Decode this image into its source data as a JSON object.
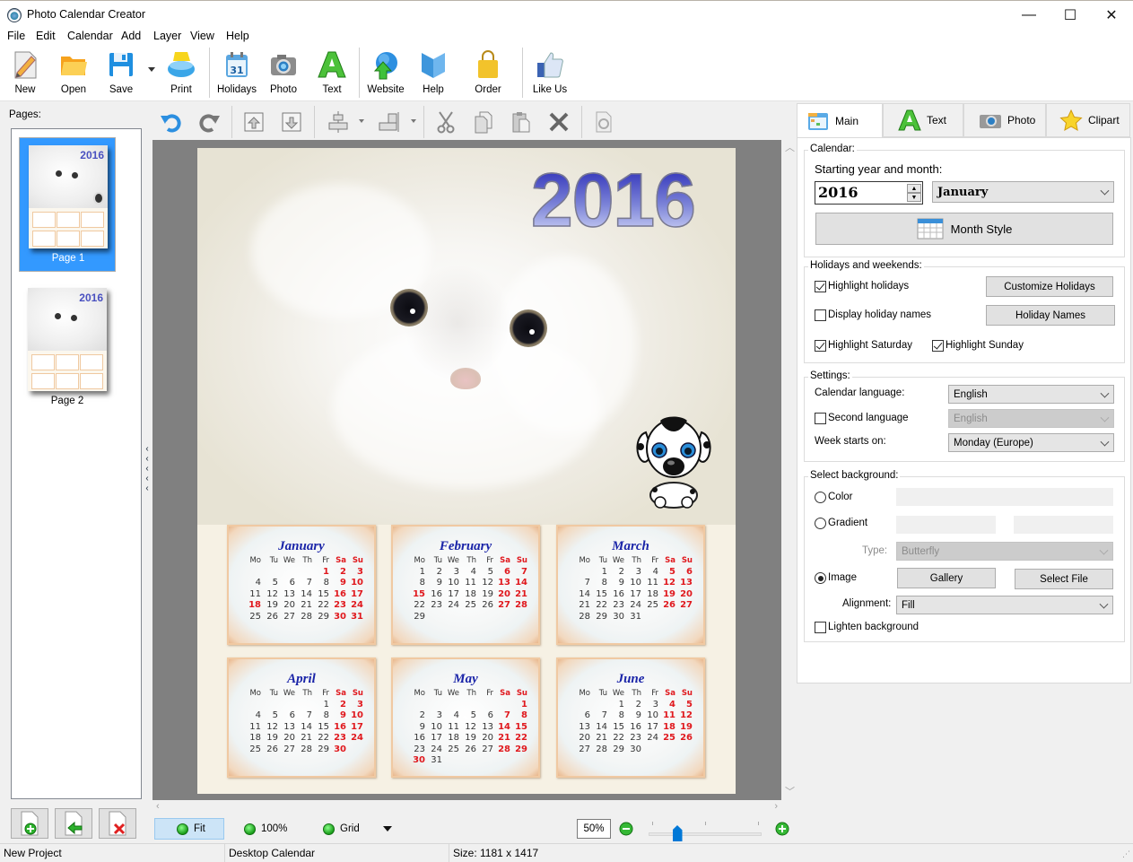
{
  "window": {
    "title": "Photo Calendar Creator",
    "minimize": "—",
    "maximize": "☐",
    "close": "✕"
  },
  "menu": [
    "File",
    "Edit",
    "Calendar",
    "Add",
    "Layer",
    "View",
    "Help"
  ],
  "toolbar": {
    "new": "New",
    "open": "Open",
    "save": "Save",
    "print": "Print",
    "holidays": "Holidays",
    "photo": "Photo",
    "text": "Text",
    "website": "Website",
    "help": "Help",
    "order": "Order",
    "like": "Like Us"
  },
  "pages": {
    "label": "Pages:",
    "items": [
      {
        "label": "Page 1",
        "selected": true
      },
      {
        "label": "Page 2",
        "selected": false
      }
    ]
  },
  "calendar_page": {
    "year": "2016",
    "weekday_headers": [
      "Mo",
      "Tu",
      "We",
      "Th",
      "Fr",
      "Sa",
      "Su"
    ],
    "months": [
      {
        "name": "January",
        "offset": 4,
        "days": 31,
        "holidays": [
          1,
          18
        ]
      },
      {
        "name": "February",
        "offset": 0,
        "days": 29,
        "holidays": [
          15
        ]
      },
      {
        "name": "March",
        "offset": 1,
        "days": 31,
        "holidays": []
      },
      {
        "name": "April",
        "offset": 4,
        "days": 30,
        "holidays": []
      },
      {
        "name": "May",
        "offset": 6,
        "days": 31,
        "holidays": [
          30
        ]
      },
      {
        "name": "June",
        "offset": 2,
        "days": 30,
        "holidays": []
      }
    ]
  },
  "tabs": [
    {
      "label": "Main",
      "active": true
    },
    {
      "label": "Text",
      "active": false
    },
    {
      "label": "Photo",
      "active": false
    },
    {
      "label": "Clipart",
      "active": false
    }
  ],
  "main": {
    "calendar_group": "Calendar:",
    "start_label": "Starting year and month:",
    "year_value": "2016",
    "month_value": "January",
    "month_style": "Month Style",
    "holidays_group": "Holidays and weekends:",
    "highlight_holidays": {
      "label": "Highlight holidays",
      "checked": true
    },
    "display_holiday_names": {
      "label": "Display holiday names",
      "checked": false
    },
    "highlight_saturday": {
      "label": "Highlight Saturday",
      "checked": true
    },
    "highlight_sunday": {
      "label": "Highlight Sunday",
      "checked": true
    },
    "customize_holidays": "Customize Holidays",
    "holiday_names": "Holiday Names",
    "settings_group": "Settings:",
    "calendar_language_label": "Calendar language:",
    "calendar_language": "English",
    "second_language": {
      "label": "Second language",
      "checked": false,
      "value": "English"
    },
    "week_starts_label": "Week starts on:",
    "week_starts": "Monday (Europe)",
    "background_group": "Select background:",
    "bg_color": {
      "label": "Color",
      "selected": false
    },
    "bg_gradient": {
      "label": "Gradient",
      "selected": false
    },
    "type_label": "Type:",
    "type_value": "Butterfly",
    "bg_image": {
      "label": "Image",
      "selected": true
    },
    "gallery": "Gallery",
    "select_file": "Select File",
    "alignment_label": "Alignment:",
    "alignment_value": "Fill",
    "lighten_background": {
      "label": "Lighten background",
      "checked": false
    }
  },
  "view": {
    "fit": "Fit",
    "hundred": "100%",
    "grid": "Grid",
    "zoom": "50%",
    "zoom_fraction": 0.25
  },
  "status": {
    "project": "New Project",
    "type": "Desktop Calendar",
    "size": "Size: 1181 x 1417"
  }
}
